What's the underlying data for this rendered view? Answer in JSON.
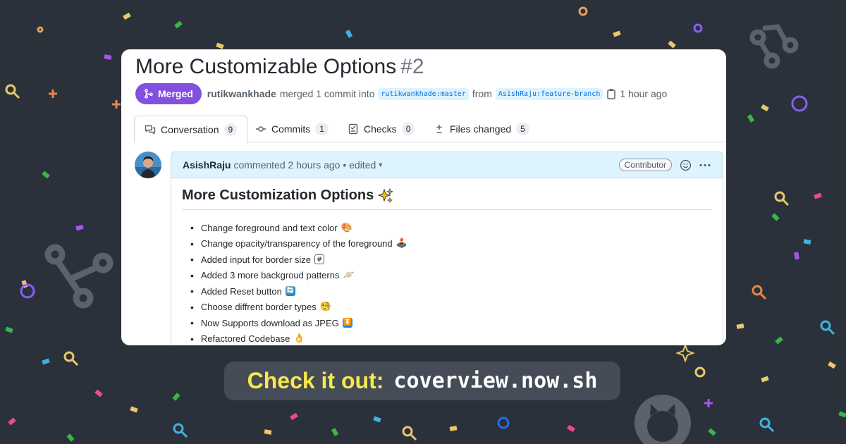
{
  "pr": {
    "title": "More Customizable Options",
    "number": "#2",
    "status": "Merged",
    "author": "rutikwankhade",
    "action": "merged 1 commit into",
    "base_branch": "rutikwankhade:master",
    "from_word": "from",
    "head_branch": "AsishRaju:feature-branch",
    "time": "1 hour ago"
  },
  "tabs": [
    {
      "label": "Conversation",
      "count": "9",
      "icon": "conversation-icon"
    },
    {
      "label": "Commits",
      "count": "1",
      "icon": "commit-icon"
    },
    {
      "label": "Checks",
      "count": "0",
      "icon": "checklist-icon"
    },
    {
      "label": "Files changed",
      "count": "5",
      "icon": "diff-icon"
    }
  ],
  "comment": {
    "author": "AsishRaju",
    "meta": "commented 2 hours ago • edited",
    "badge": "Contributor",
    "heading": "More Customization Options",
    "items": [
      {
        "text": "Change foreground and text color",
        "emoji": "🎨"
      },
      {
        "text": "Change opacity/transparency of the foreground",
        "emoji": "🕹️"
      },
      {
        "text": "Added input for border size",
        "emoji": "#"
      },
      {
        "text": "Added 3 more backgroud patterns",
        "emoji": "🪐"
      },
      {
        "text": "Added Reset button",
        "emoji": "🔄"
      },
      {
        "text": "Choose diffrent border types",
        "emoji": "🧐"
      },
      {
        "text": "Now Supports download as JPEG",
        "emoji": "⏬"
      },
      {
        "text": "Refactored Codebase",
        "emoji": "👌"
      }
    ]
  },
  "cta": {
    "label": "Check it out:",
    "url": "coverview.now.sh"
  },
  "colors": {
    "background": "#2b313a",
    "merged": "#8250df",
    "cta_label": "#f7e94a",
    "link": "#0969da"
  }
}
